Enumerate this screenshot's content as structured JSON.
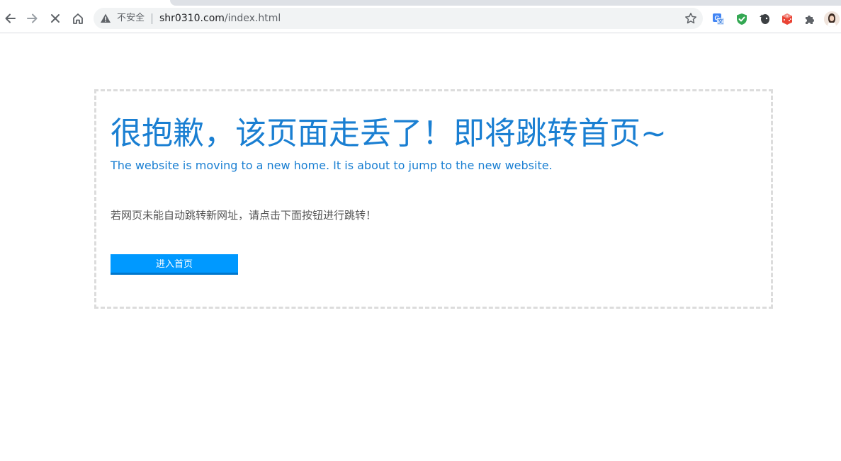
{
  "browser": {
    "security_label": "不安全",
    "url_host": "shr0310.com",
    "url_path": "/index.html",
    "icons": {
      "back": "back-arrow-icon",
      "forward": "forward-arrow-icon",
      "stop": "stop-loading-icon",
      "home": "home-icon",
      "warning": "warning-triangle-icon",
      "bookmark": "star-icon",
      "extensions": [
        "translate-extension-icon",
        "shield-extension-icon",
        "evernote-extension-icon",
        "dice-extension-icon",
        "puzzle-extensions-icon"
      ],
      "profile": "profile-avatar"
    }
  },
  "page": {
    "headline": "很抱歉，该页面走丢了！即将跳转首页~",
    "subline": "The website is moving to a new home. It is about to jump to the new website.",
    "instruction": "若网页未能自动跳转新网址，请点击下面按钮进行跳转！",
    "button_label": "进入首页"
  },
  "colors": {
    "headline": "#1a7fd2",
    "button": "#0099ff",
    "border": "#dcdcdc",
    "instruction": "#555555"
  }
}
